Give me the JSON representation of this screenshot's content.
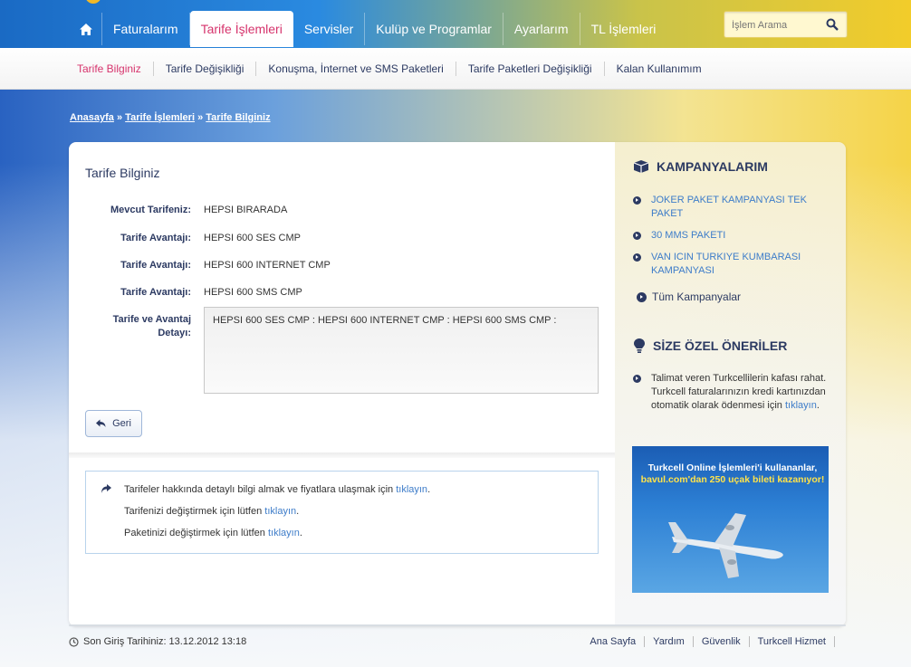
{
  "nav": {
    "items": [
      {
        "label": "Faturalarım"
      },
      {
        "label": "Tarife İşlemleri"
      },
      {
        "label": "Servisler"
      },
      {
        "label": "Kulüp ve Programlar"
      },
      {
        "label": "Ayarlarım"
      },
      {
        "label": "TL İşlemleri"
      }
    ],
    "active_index": 1
  },
  "search": {
    "placeholder": "İşlem Arama"
  },
  "subnav": {
    "items": [
      {
        "label": "Tarife Bilginiz"
      },
      {
        "label": "Tarife Değişikliği"
      },
      {
        "label": "Konuşma, İnternet ve SMS Paketleri"
      },
      {
        "label": "Tarife Paketleri Değişikliği"
      },
      {
        "label": "Kalan Kullanımım"
      }
    ]
  },
  "breadcrumb": {
    "items": [
      "Anasayfa",
      "Tarife İşlemleri",
      "Tarife Bilginiz"
    ],
    "separator": "»"
  },
  "main": {
    "title": "Tarife Bilginiz",
    "rows": [
      {
        "label": "Mevcut Tarifeniz:",
        "value": "HEPSI BIRARADA"
      },
      {
        "label": "Tarife Avantajı:",
        "value": "HEPSI 600 SES CMP"
      },
      {
        "label": "Tarife Avantajı:",
        "value": "HEPSI 600 INTERNET CMP"
      },
      {
        "label": "Tarife Avantajı:",
        "value": "HEPSI 600 SMS CMP"
      }
    ],
    "detail_label_1": "Tarife ve Avantaj",
    "detail_label_2": "Detayı:",
    "detail_value": "HEPSI 600 SES CMP : HEPSI 600 INTERNET CMP : HEPSI 600 SMS CMP :",
    "back_label": "Geri"
  },
  "info": {
    "lines": [
      {
        "text": "Tarifeler hakkında detaylı bilgi almak ve fiyatlara ulaşmak için",
        "link": "tıklayın",
        "end": "."
      },
      {
        "text": "Tarifenizi değiştirmek için lütfen",
        "link": "tıklayın",
        "end": "."
      },
      {
        "text": "Paketinizi değiştirmek için lütfen",
        "link": "tıklayın",
        "end": "."
      }
    ]
  },
  "sidebar": {
    "campaigns_title": "KAMPANYALARIM",
    "campaigns": [
      {
        "line1": "JOKER PAKET KAMPANYASI TEK",
        "line2": "PAKET"
      },
      {
        "line1": "30 MMS PAKETI",
        "line2": ""
      },
      {
        "line1": "VAN ICIN TURKIYE KUMBARASI",
        "line2": "KAMPANYASI"
      }
    ],
    "all_campaigns": "Tüm Kampanyalar",
    "suggestions_title": "SİZE ÖZEL ÖNERİLER",
    "suggestion": {
      "line1": "Talimat veren Turkcellilerin kafası rahat.",
      "line2": "Turkcell faturalarınızın kredi kartınızdan",
      "line3": "otomatik olarak ödenmesi için",
      "link": "tıklayın",
      "end": "."
    },
    "ad": {
      "line1": "Turkcell Online İşlemleri'i kullananlar,",
      "line2": "bavul.com'dan 250 uçak bileti kazanıyor!"
    }
  },
  "footer": {
    "last_login": "Son Giriş Tarihiniz: 13.12.2012 13:18",
    "links": [
      "Ana Sayfa",
      "Yardım",
      "Güvenlik",
      "Turkcell Hizmet"
    ]
  }
}
